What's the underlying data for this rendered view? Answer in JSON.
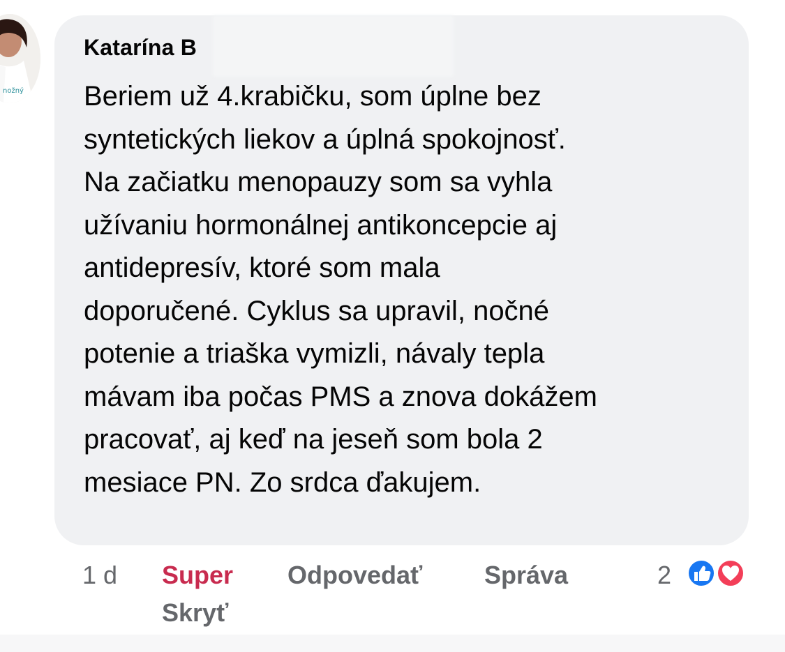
{
  "comment": {
    "author": "Katarína B",
    "lines": [
      "Beriem už 4.krabičku, som úplne bez",
      "syntetických liekov a úplná spokojnosť.",
      "Na začiatku menopauzy som sa vyhla",
      "užívaniu hormonálnej antikoncepcie aj",
      "antidepresív, ktoré som mala",
      "doporučené. Cyklus sa upravil, nočné",
      "potenie a triaška vymizli, návaly tepla",
      "mávam iba počas PMS a znova dokážem",
      "pracovať, aj keď na jeseň som bola 2",
      "mesiace PN. Zo srdca ďakujem."
    ]
  },
  "avatar": {
    "visible_text": "nožný"
  },
  "actions": {
    "time": "1 d",
    "reaction_label": "Super",
    "reply_label": "Odpovedať",
    "report_label": "Správa",
    "hide_label": "Skryť"
  },
  "reactions": {
    "count": "2",
    "icons": [
      "like-icon",
      "love-icon"
    ],
    "like_color": "#1877f2",
    "love_color": "#f33e58"
  },
  "colors": {
    "bubble": "#f0f1f3",
    "primary_text": "#050505",
    "secondary_text": "#65676b",
    "active_reaction": "#c82b4f"
  }
}
